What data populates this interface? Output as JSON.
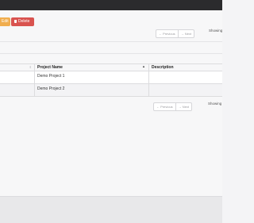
{
  "toolbar": {
    "edit_label": "Edit",
    "delete_label": "Delete"
  },
  "pager_top": {
    "previous": "← Previous",
    "next": "→ Next",
    "showing": "Showing"
  },
  "table": {
    "columns": [
      "",
      "Project Name",
      "Description"
    ],
    "rows": [
      {
        "col1": "",
        "name": "Demo Project 1",
        "description": ""
      },
      {
        "col1": "",
        "name": "Demo Project 2",
        "description": ""
      }
    ]
  },
  "pager_bottom": {
    "previous": "← Previous",
    "next": "→ Next",
    "showing": "Showing"
  }
}
